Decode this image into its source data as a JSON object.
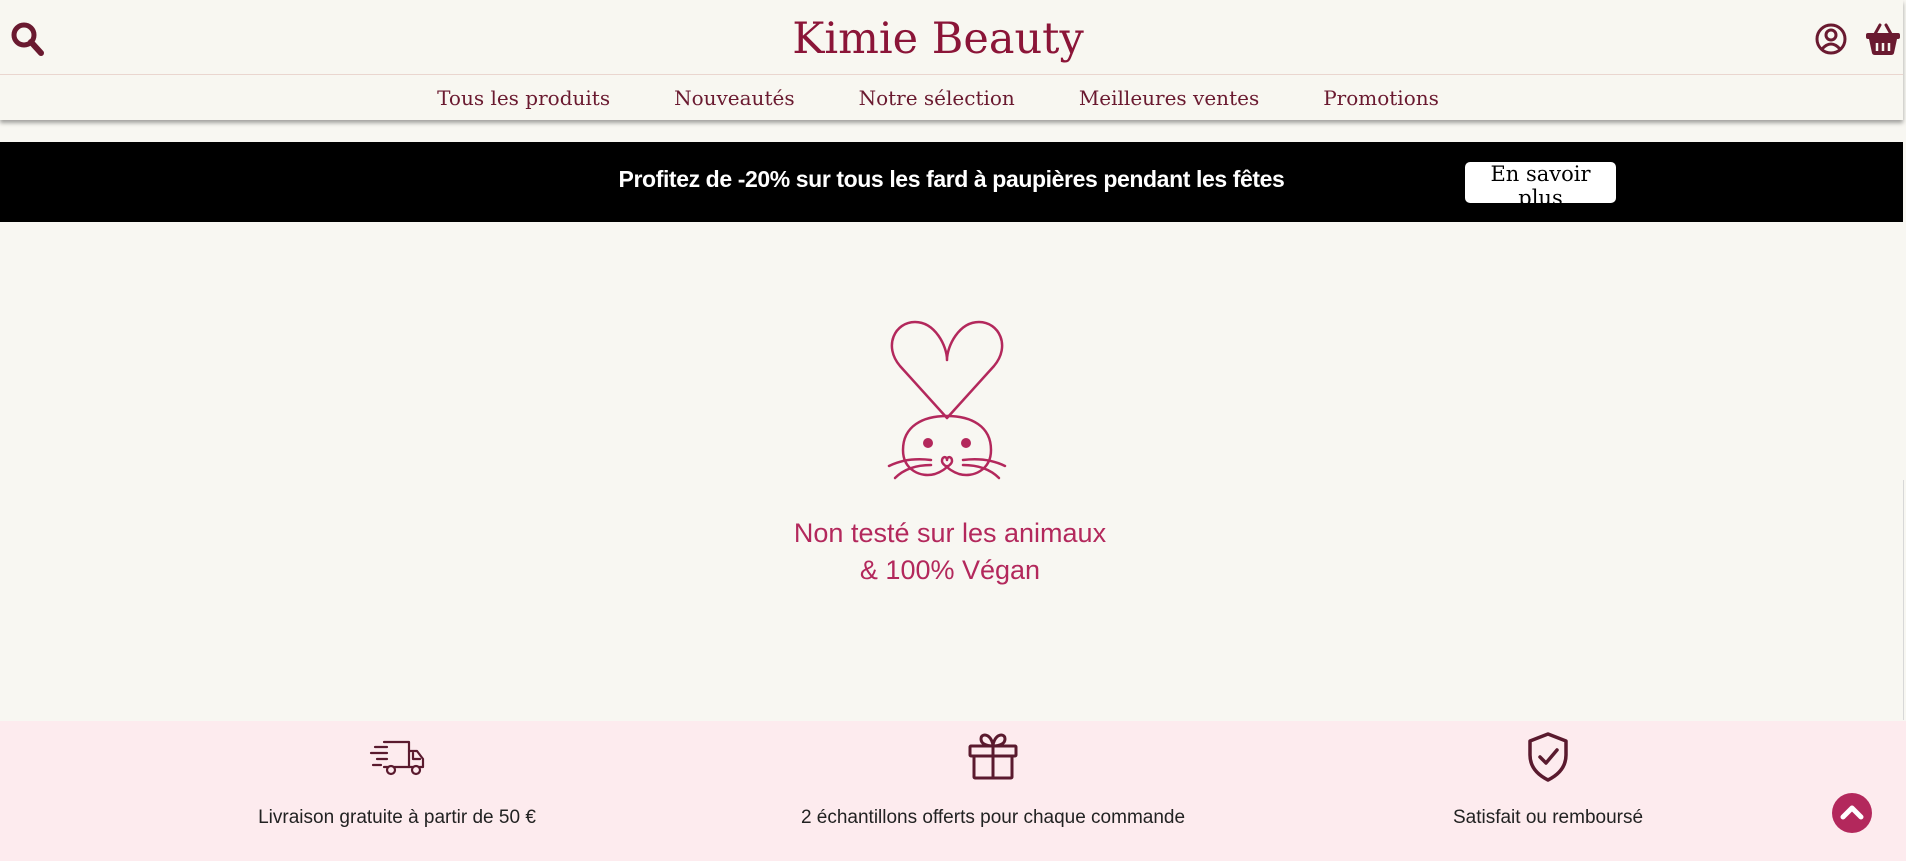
{
  "colors": {
    "brand": "#8b1538",
    "accent": "#b3285c",
    "nav_text": "#6a1a30",
    "banner_bg": "#000000",
    "benefits_bg": "#fdebee",
    "page_bg": "#f8f7f2"
  },
  "header": {
    "brand": "Kimie Beauty",
    "icons": {
      "search": "search-icon",
      "account": "user-circle-icon",
      "basket": "shopping-basket-icon"
    },
    "nav": [
      {
        "label": "Tous les produits"
      },
      {
        "label": "Nouveautés"
      },
      {
        "label": "Notre sélection"
      },
      {
        "label": "Meilleures ventes"
      },
      {
        "label": "Promotions"
      }
    ]
  },
  "promo_banner": {
    "text": "Profitez de -20% sur tous les fard à paupières pendant les fêtes",
    "button_label": "En savoir plus"
  },
  "feature": {
    "icon": "bunny-icon",
    "line1": "Non testé sur les animaux",
    "line2": "& 100% Végan"
  },
  "benefits": [
    {
      "icon": "delivery-truck-icon",
      "label": "Livraison gratuite à partir de 50 €"
    },
    {
      "icon": "gift-icon",
      "label": "2 échantillons offerts pour chaque commande"
    },
    {
      "icon": "shield-check-icon",
      "label": "Satisfait ou remboursé"
    }
  ],
  "scroll_top": {
    "icon": "chevron-up-icon"
  }
}
